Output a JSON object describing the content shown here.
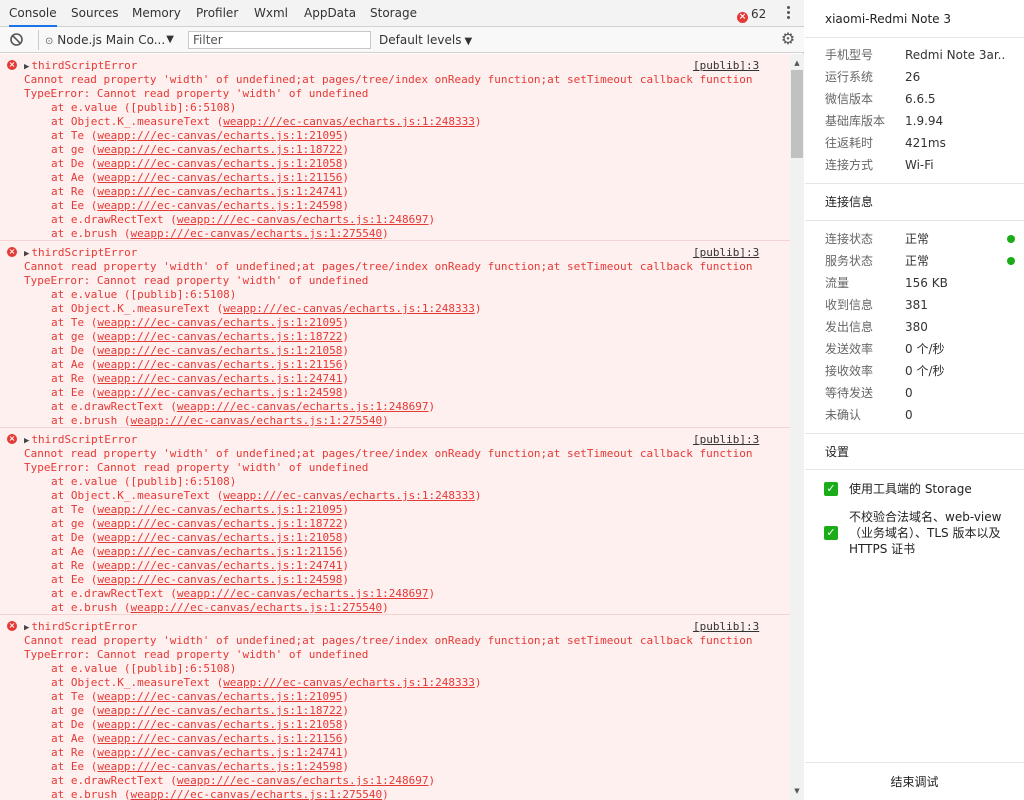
{
  "devtools": {
    "tabs": [
      "Console",
      "Sources",
      "Memory",
      "Profiler",
      "Wxml",
      "AppData",
      "Storage"
    ],
    "active_tab": "Console",
    "error_count": "62",
    "context": "Node.js Main Co...",
    "filter_placeholder": "Filter",
    "levels": "Default levels"
  },
  "console": {
    "entries": [
      {
        "title": "thirdScriptError",
        "source": "[publib]:3",
        "message": "Cannot read property 'width' of undefined;at pages/tree/index onReady function;at setTimeout callback function",
        "error": "TypeError: Cannot read property 'width' of undefined",
        "stack": [
          {
            "at": "at e.value ([publib]:6:5108)",
            "link": ""
          },
          {
            "at": "at Object.K_.measureText (",
            "link": "weapp:///ec-canvas/echarts.js:1:248333"
          },
          {
            "at": "at Te (",
            "link": "weapp:///ec-canvas/echarts.js:1:21095"
          },
          {
            "at": "at ge (",
            "link": "weapp:///ec-canvas/echarts.js:1:18722"
          },
          {
            "at": "at De (",
            "link": "weapp:///ec-canvas/echarts.js:1:21058"
          },
          {
            "at": "at Ae (",
            "link": "weapp:///ec-canvas/echarts.js:1:21156"
          },
          {
            "at": "at Re (",
            "link": "weapp:///ec-canvas/echarts.js:1:24741"
          },
          {
            "at": "at Ee (",
            "link": "weapp:///ec-canvas/echarts.js:1:24598"
          },
          {
            "at": "at e.drawRectText (",
            "link": "weapp:///ec-canvas/echarts.js:1:248697"
          },
          {
            "at": "at e.brush (",
            "link": "weapp:///ec-canvas/echarts.js:1:275540"
          }
        ]
      },
      {
        "title": "thirdScriptError",
        "source": "[publib]:3",
        "message": "Cannot read property 'width' of undefined;at pages/tree/index onReady function;at setTimeout callback function",
        "error": "TypeError: Cannot read property 'width' of undefined",
        "stack": [
          {
            "at": "at e.value ([publib]:6:5108)",
            "link": ""
          },
          {
            "at": "at Object.K_.measureText (",
            "link": "weapp:///ec-canvas/echarts.js:1:248333"
          },
          {
            "at": "at Te (",
            "link": "weapp:///ec-canvas/echarts.js:1:21095"
          },
          {
            "at": "at ge (",
            "link": "weapp:///ec-canvas/echarts.js:1:18722"
          },
          {
            "at": "at De (",
            "link": "weapp:///ec-canvas/echarts.js:1:21058"
          },
          {
            "at": "at Ae (",
            "link": "weapp:///ec-canvas/echarts.js:1:21156"
          },
          {
            "at": "at Re (",
            "link": "weapp:///ec-canvas/echarts.js:1:24741"
          },
          {
            "at": "at Ee (",
            "link": "weapp:///ec-canvas/echarts.js:1:24598"
          },
          {
            "at": "at e.drawRectText (",
            "link": "weapp:///ec-canvas/echarts.js:1:248697"
          },
          {
            "at": "at e.brush (",
            "link": "weapp:///ec-canvas/echarts.js:1:275540"
          }
        ]
      },
      {
        "title": "thirdScriptError",
        "source": "[publib]:3",
        "message": "Cannot read property 'width' of undefined;at pages/tree/index onReady function;at setTimeout callback function",
        "error": "TypeError: Cannot read property 'width' of undefined",
        "stack": [
          {
            "at": "at e.value ([publib]:6:5108)",
            "link": ""
          },
          {
            "at": "at Object.K_.measureText (",
            "link": "weapp:///ec-canvas/echarts.js:1:248333"
          },
          {
            "at": "at Te (",
            "link": "weapp:///ec-canvas/echarts.js:1:21095"
          },
          {
            "at": "at ge (",
            "link": "weapp:///ec-canvas/echarts.js:1:18722"
          },
          {
            "at": "at De (",
            "link": "weapp:///ec-canvas/echarts.js:1:21058"
          },
          {
            "at": "at Ae (",
            "link": "weapp:///ec-canvas/echarts.js:1:21156"
          },
          {
            "at": "at Re (",
            "link": "weapp:///ec-canvas/echarts.js:1:24741"
          },
          {
            "at": "at Ee (",
            "link": "weapp:///ec-canvas/echarts.js:1:24598"
          },
          {
            "at": "at e.drawRectText (",
            "link": "weapp:///ec-canvas/echarts.js:1:248697"
          },
          {
            "at": "at e.brush (",
            "link": "weapp:///ec-canvas/echarts.js:1:275540"
          }
        ]
      },
      {
        "title": "thirdScriptError",
        "source": "[publib]:3",
        "message": "Cannot read property 'width' of undefined;at pages/tree/index onReady function;at setTimeout callback function",
        "error": "TypeError: Cannot read property 'width' of undefined",
        "stack": [
          {
            "at": "at e.value ([publib]:6:5108)",
            "link": ""
          },
          {
            "at": "at Object.K_.measureText (",
            "link": "weapp:///ec-canvas/echarts.js:1:248333"
          },
          {
            "at": "at Te (",
            "link": "weapp:///ec-canvas/echarts.js:1:21095"
          },
          {
            "at": "at ge (",
            "link": "weapp:///ec-canvas/echarts.js:1:18722"
          },
          {
            "at": "at De (",
            "link": "weapp:///ec-canvas/echarts.js:1:21058"
          },
          {
            "at": "at Ae (",
            "link": "weapp:///ec-canvas/echarts.js:1:21156"
          },
          {
            "at": "at Re (",
            "link": "weapp:///ec-canvas/echarts.js:1:24741"
          },
          {
            "at": "at Ee (",
            "link": "weapp:///ec-canvas/echarts.js:1:24598"
          },
          {
            "at": "at e.drawRectText (",
            "link": "weapp:///ec-canvas/echarts.js:1:248697"
          },
          {
            "at": "at e.brush (",
            "link": "weapp:///ec-canvas/echarts.js:1:275540"
          }
        ]
      }
    ]
  },
  "panel": {
    "device_title": "xiaomi-Redmi Note 3",
    "device_info": [
      {
        "k": "手机型号",
        "v": "Redmi Note 3ar..."
      },
      {
        "k": "运行系统",
        "v": "26"
      },
      {
        "k": "微信版本",
        "v": "6.6.5"
      },
      {
        "k": "基础库版本",
        "v": "1.9.94"
      },
      {
        "k": "往返耗时",
        "v": "421ms"
      },
      {
        "k": "连接方式",
        "v": "Wi-Fi"
      }
    ],
    "conn_title": "连接信息",
    "conn_info": [
      {
        "k": "连接状态",
        "v": "正常",
        "dot": true
      },
      {
        "k": "服务状态",
        "v": "正常",
        "dot": true
      },
      {
        "k": "流量",
        "v": "156 KB"
      },
      {
        "k": "收到信息",
        "v": "381"
      },
      {
        "k": "发出信息",
        "v": "380"
      },
      {
        "k": "发送效率",
        "v": "0 个/秒"
      },
      {
        "k": "接收效率",
        "v": "0 个/秒"
      },
      {
        "k": "等待发送",
        "v": "0"
      },
      {
        "k": "未确认",
        "v": "0"
      }
    ],
    "settings_title": "设置",
    "settings": [
      {
        "label": "使用工具端的 Storage",
        "checked": true
      },
      {
        "label": "不校验合法域名、web-view（业务域名）、TLS 版本以及 HTTPS 证书",
        "checked": true
      }
    ],
    "end_debug": "结束调试"
  },
  "colors": {
    "error_red": "#e53935",
    "error_bg": "#fff0f0",
    "ok_green": "#1aad19",
    "tab_active": "#1a73e8"
  }
}
